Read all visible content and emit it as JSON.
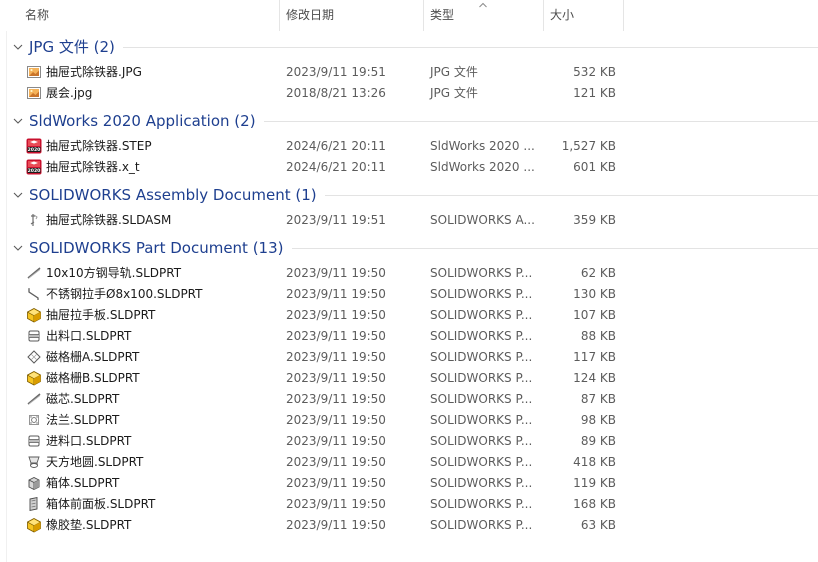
{
  "columns": {
    "name": "名称",
    "modified": "修改日期",
    "type": "类型",
    "size": "大小"
  },
  "groups": [
    {
      "title": "JPG 文件 (2)",
      "files": [
        {
          "name": "抽屉式除铁器.JPG",
          "modified": "2023/9/11 19:51",
          "type": "JPG 文件",
          "size": "532 KB",
          "icon": "jpg-image-icon"
        },
        {
          "name": "展会.jpg",
          "modified": "2018/8/21 13:26",
          "type": "JPG 文件",
          "size": "121 KB",
          "icon": "jpg-image-icon"
        }
      ]
    },
    {
      "title": "SldWorks 2020 Application (2)",
      "files": [
        {
          "name": "抽屉式除铁器.STEP",
          "modified": "2024/6/21 20:11",
          "type": "SldWorks 2020 ...",
          "size": "1,527 KB",
          "icon": "solidworks-2020-icon"
        },
        {
          "name": "抽屉式除铁器.x_t",
          "modified": "2024/6/21 20:11",
          "type": "SldWorks 2020 ...",
          "size": "601 KB",
          "icon": "solidworks-2020-icon"
        }
      ]
    },
    {
      "title": "SOLIDWORKS Assembly Document (1)",
      "files": [
        {
          "name": "抽屉式除铁器.SLDASM",
          "modified": "2023/9/11 19:51",
          "type": "SOLIDWORKS A...",
          "size": "359 KB",
          "icon": "assembly-thumbnail-icon"
        }
      ]
    },
    {
      "title": "SOLIDWORKS Part Document (13)",
      "files": [
        {
          "name": "10x10方钢导轨.SLDPRT",
          "modified": "2023/9/11 19:50",
          "type": "SOLIDWORKS P...",
          "size": "62 KB",
          "icon": "rail-thumbnail-icon"
        },
        {
          "name": "不锈钢拉手Ø8x100.SLDPRT",
          "modified": "2023/9/11 19:50",
          "type": "SOLIDWORKS P...",
          "size": "130 KB",
          "icon": "handle-thumbnail-icon"
        },
        {
          "name": "抽屉拉手板.SLDPRT",
          "modified": "2023/9/11 19:50",
          "type": "SOLIDWORKS P...",
          "size": "107 KB",
          "icon": "part-cube-icon"
        },
        {
          "name": "出料口.SLDPRT",
          "modified": "2023/9/11 19:50",
          "type": "SOLIDWORKS P...",
          "size": "88 KB",
          "icon": "outlet-thumbnail-icon"
        },
        {
          "name": "磁格栅A.SLDPRT",
          "modified": "2023/9/11 19:50",
          "type": "SOLIDWORKS P...",
          "size": "117 KB",
          "icon": "grid-thumbnail-icon"
        },
        {
          "name": "磁格栅B.SLDPRT",
          "modified": "2023/9/11 19:50",
          "type": "SOLIDWORKS P...",
          "size": "124 KB",
          "icon": "part-cube-icon"
        },
        {
          "name": "磁芯.SLDPRT",
          "modified": "2023/9/11 19:50",
          "type": "SOLIDWORKS P...",
          "size": "87 KB",
          "icon": "rail-thumbnail-icon"
        },
        {
          "name": "法兰.SLDPRT",
          "modified": "2023/9/11 19:50",
          "type": "SOLIDWORKS P...",
          "size": "98 KB",
          "icon": "flange-thumbnail-icon"
        },
        {
          "name": "进料口.SLDPRT",
          "modified": "2023/9/11 19:50",
          "type": "SOLIDWORKS P...",
          "size": "89 KB",
          "icon": "outlet-thumbnail-icon"
        },
        {
          "name": "天方地圆.SLDPRT",
          "modified": "2023/9/11 19:50",
          "type": "SOLIDWORKS P...",
          "size": "418 KB",
          "icon": "transition-thumbnail-icon"
        },
        {
          "name": "箱体.SLDPRT",
          "modified": "2023/9/11 19:50",
          "type": "SOLIDWORKS P...",
          "size": "119 KB",
          "icon": "box-thumbnail-icon"
        },
        {
          "name": "箱体前面板.SLDPRT",
          "modified": "2023/9/11 19:50",
          "type": "SOLIDWORKS P...",
          "size": "168 KB",
          "icon": "panel-thumbnail-icon"
        },
        {
          "name": "橡胶垫.SLDPRT",
          "modified": "2023/9/11 19:50",
          "type": "SOLIDWORKS P...",
          "size": "63 KB",
          "icon": "part-cube-icon"
        }
      ]
    }
  ],
  "colors": {
    "group_title": "#1e3f8f",
    "header_text": "#4c4c4c",
    "secondary_text": "#5c5c5c",
    "divider": "#e3e3e3"
  }
}
